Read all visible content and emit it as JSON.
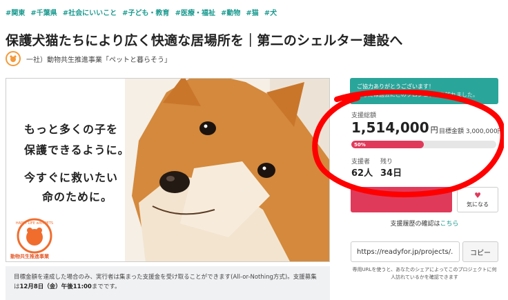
{
  "tags": [
    "#関東",
    "#千葉県",
    "#社会にいいこと",
    "#子ども・教育",
    "#医療・福祉",
    "#動物",
    "#猫",
    "#犬"
  ],
  "title": "保護犬猫たちにより広く快適な居場所を｜第二のシェルター建設へ",
  "owner": "一社）動物共生推進事業「ペットと暮らそう」",
  "hero": {
    "lines": [
      "もっと多くの子を",
      "保護できるように。",
      "今すぐに救いたい",
      "命のために。"
    ],
    "org_name": "動物共生推進事業",
    "logo_text": "HAPPY LIFE with PETS"
  },
  "note": {
    "text_before": "目標金額を達成した場合のみ、実行者は集まった支援金を受け取ることができます(All-or-Nothing方式)。支援募集は",
    "deadline": "12月8日（金）午後11:00",
    "text_after": "までです。"
  },
  "thanks": {
    "line1": "ご協力ありがとうございます！",
    "line2": "あなたは過去にこのプロジェクトを訪れました。"
  },
  "funding": {
    "total_label": "支援総額",
    "amount": "1,514,000",
    "currency": "円",
    "goal": "目標金額 3,000,000円",
    "progress_label": "50%",
    "progress": 0.5
  },
  "stats": {
    "supporters_label": "支援者",
    "supporters_value": "62人",
    "remaining_label": "残り",
    "remaining_value": "34日"
  },
  "fav_label": "気になる",
  "history": {
    "prefix": "支援履歴の確認は",
    "link": "こちら"
  },
  "share": {
    "url": "https://readyfor.jp/projects/...",
    "copy_label": "コピー",
    "note": "専用URLを使うと、あなたのシェアによってこのプロジェクトに何人訪れているかを確認できます"
  },
  "colors": {
    "accent": "#e03a5b",
    "teal": "#2aa59a",
    "annotation": "#ff0000"
  }
}
